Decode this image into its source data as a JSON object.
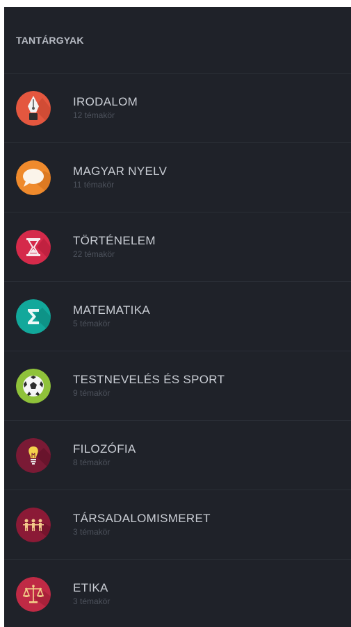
{
  "header": {
    "title": "TANTÁRGYAK"
  },
  "subjects": [
    {
      "name": "IRODALOM",
      "count": "12 témakör",
      "icon": "fountain-pen-icon",
      "color": "#e4573f"
    },
    {
      "name": "MAGYAR NYELV",
      "count": "11 témakör",
      "icon": "speech-bubble-icon",
      "color": "#ef8a2c"
    },
    {
      "name": "TÖRTÉNELEM",
      "count": "22 témakör",
      "icon": "hourglass-icon",
      "color": "#d52a4a"
    },
    {
      "name": "MATEMATIKA",
      "count": "5 témakör",
      "icon": "sigma-icon",
      "color": "#12a89b"
    },
    {
      "name": "TESTNEVELÉS ÉS SPORT",
      "count": "9 témakör",
      "icon": "soccer-ball-icon",
      "color": "#8fc23a"
    },
    {
      "name": "FILOZÓFIA",
      "count": "8 témakör",
      "icon": "lightbulb-icon",
      "color": "#7a1a35"
    },
    {
      "name": "TÁRSADALOMISMERET",
      "count": "3 témakör",
      "icon": "people-icon",
      "color": "#8b1a36"
    },
    {
      "name": "ETIKA",
      "count": "3 témakör",
      "icon": "scales-icon",
      "color": "#bf2a45"
    }
  ]
}
